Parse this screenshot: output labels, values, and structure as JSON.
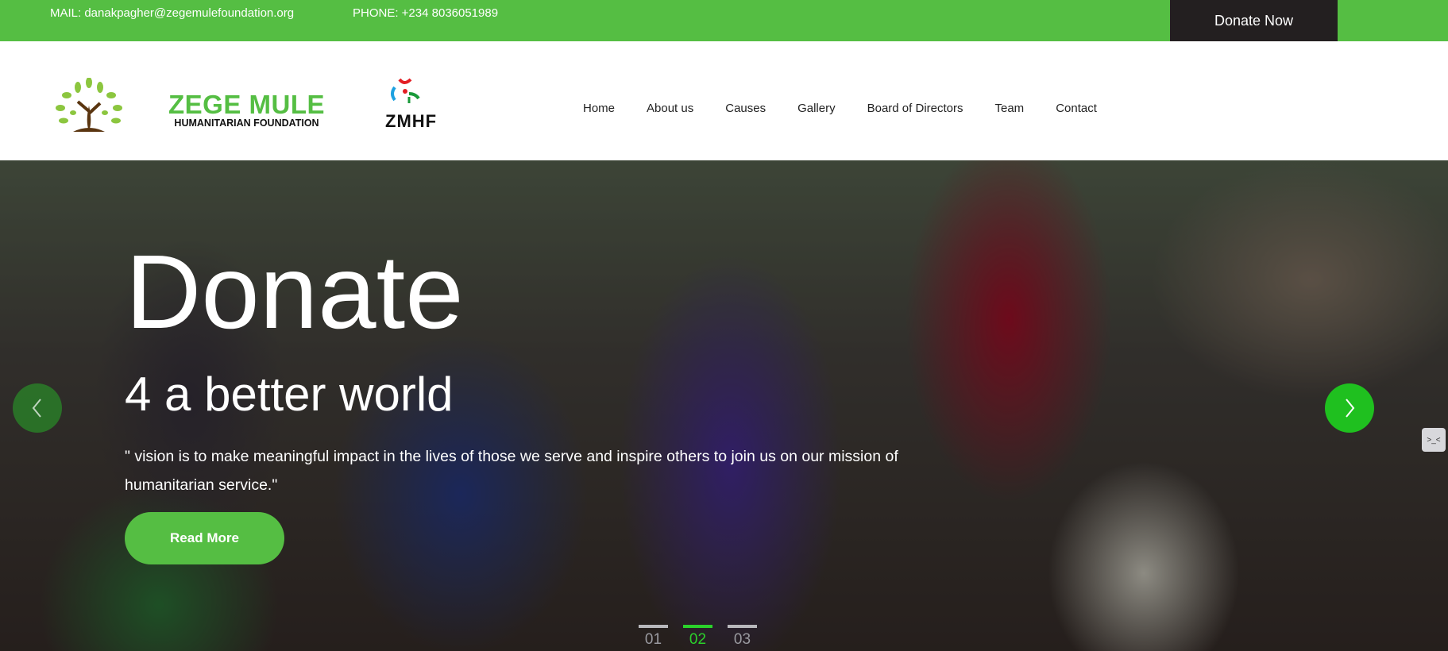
{
  "topbar": {
    "mail": "MAIL: danakpagher@zegemulefoundation.org",
    "phone": "PHONE: +234 8036051989",
    "donate_label": "Donate Now"
  },
  "logo": {
    "title": "ZEGE MULE",
    "subtitle": "HUMANITARIAN FOUNDATION",
    "abbr": "ZMHF"
  },
  "nav": [
    "Home",
    "About us",
    "Causes",
    "Gallery",
    "Board of Directors",
    "Team",
    "Contact"
  ],
  "hero": {
    "title": "Donate",
    "subtitle": "4 a better world",
    "quote": "\" vision is to make meaningful impact in the lives of those we serve and inspire others to join us on our mission of humanitarian service.\"",
    "button": "Read More"
  },
  "pager": {
    "pages": [
      "01",
      "02",
      "03"
    ],
    "active": "02"
  },
  "colors": {
    "brand": "#55be43",
    "dark": "#231f20",
    "arrow": "#1fc01f"
  }
}
